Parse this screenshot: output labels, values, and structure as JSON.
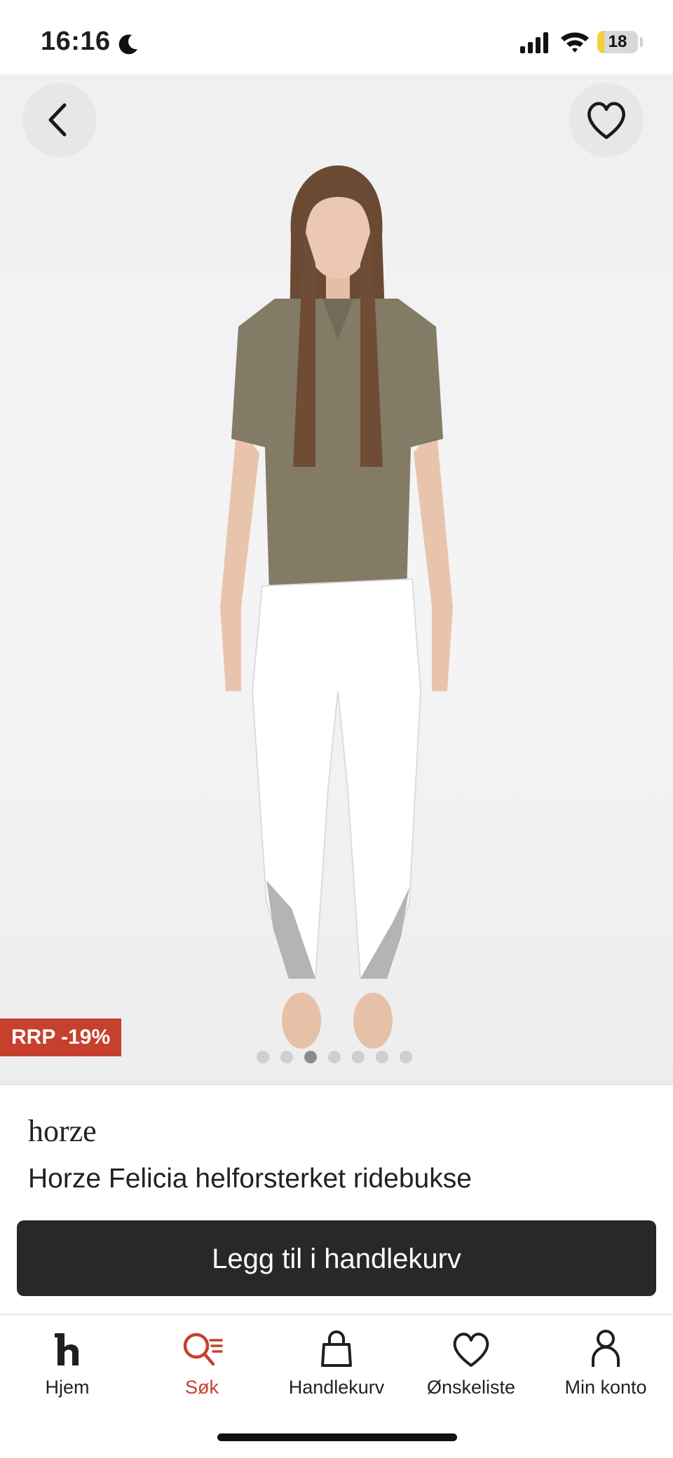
{
  "status_bar": {
    "time": "16:16",
    "battery": "18",
    "battery_level": 0.18
  },
  "product": {
    "discount_badge": "RRP -19%",
    "brand": "horze",
    "title": "Horze Felicia helforsterket ridebukse",
    "image_count": 7,
    "active_image": 3
  },
  "cta": {
    "label": "Legg til i handlekurv"
  },
  "tabs": [
    {
      "label": "Hjem",
      "icon": "home-logo-icon",
      "active": false
    },
    {
      "label": "Søk",
      "icon": "search-icon",
      "active": true
    },
    {
      "label": "Handlekurv",
      "icon": "shopping-bag-icon",
      "active": false
    },
    {
      "label": "Ønskeliste",
      "icon": "heart-icon",
      "active": false
    },
    {
      "label": "Min konto",
      "icon": "user-icon",
      "active": false
    }
  ],
  "colors": {
    "accent": "#c6402e",
    "cta_bg": "#282828",
    "badge_bg": "#c6402e"
  }
}
